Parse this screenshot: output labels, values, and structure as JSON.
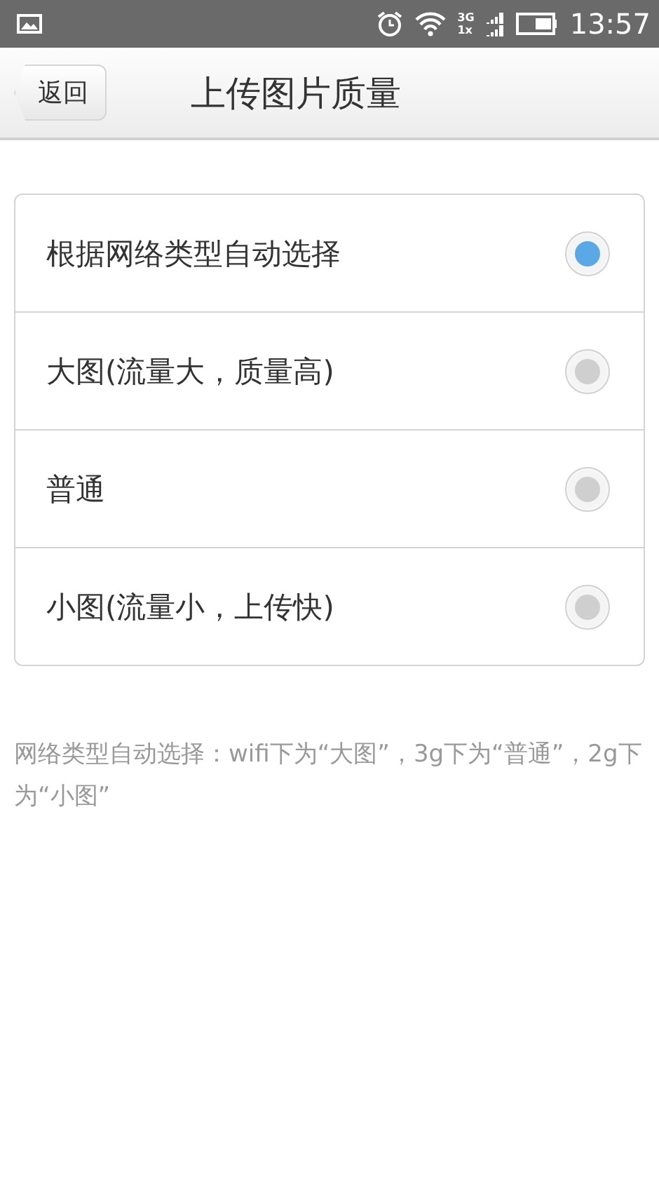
{
  "status_bar": {
    "network_top": "3G",
    "network_bottom": "1x",
    "time": "13:57"
  },
  "header": {
    "back": "返回",
    "title": "上传图片质量"
  },
  "options": [
    {
      "label": "根据网络类型自动选择",
      "selected": true
    },
    {
      "label": "大图(流量大，质量高)",
      "selected": false
    },
    {
      "label": "普通",
      "selected": false
    },
    {
      "label": "小图(流量小，上传快)",
      "selected": false
    }
  ],
  "note": "网络类型自动选择：wifi下为“大图”，3g下为“普通”，2g下为“小图”"
}
